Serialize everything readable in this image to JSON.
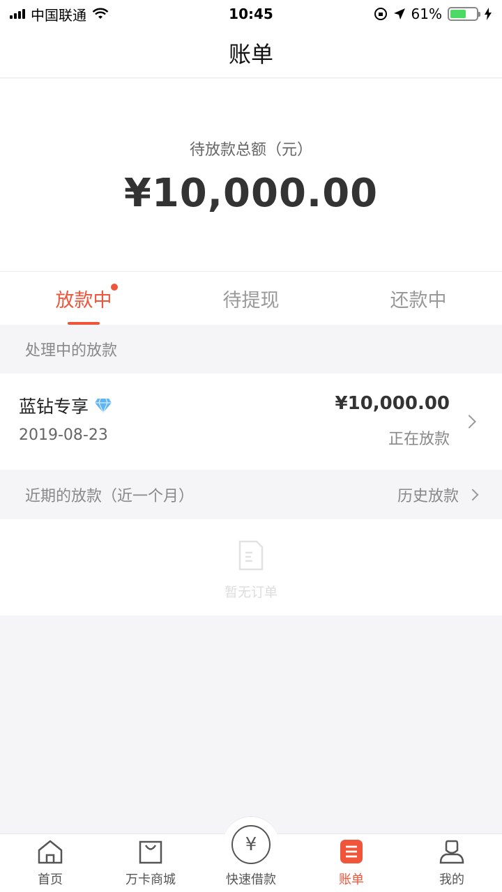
{
  "status_bar": {
    "carrier": "中国联通",
    "time": "10:45",
    "battery_text": "61%",
    "battery_level": 0.61
  },
  "nav": {
    "title": "账单"
  },
  "summary": {
    "label": "待放款总额（元）",
    "amount": "¥10,000.00"
  },
  "tabs": [
    {
      "label": "放款中",
      "active": true,
      "has_dot": true
    },
    {
      "label": "待提现",
      "active": false
    },
    {
      "label": "还款中",
      "active": false
    }
  ],
  "processing": {
    "header": "处理中的放款",
    "item": {
      "name": "蓝钻专享",
      "date": "2019-08-23",
      "amount": "¥10,000.00",
      "status": "正在放款"
    }
  },
  "recent": {
    "header": "近期的放款（近一个月）",
    "history_link": "历史放款",
    "empty_text": "暂无订单"
  },
  "tab_bar": {
    "items": [
      {
        "label": "首页",
        "icon": "home-icon"
      },
      {
        "label": "万卡商城",
        "icon": "shopping-bag-icon"
      },
      {
        "label": "快速借款",
        "icon": "yuan-circle-icon"
      },
      {
        "label": "账单",
        "icon": "bill-icon",
        "active": true
      },
      {
        "label": "我的",
        "icon": "user-icon"
      }
    ]
  },
  "colors": {
    "accent": "#f0553a",
    "battery": "#4cd964"
  }
}
